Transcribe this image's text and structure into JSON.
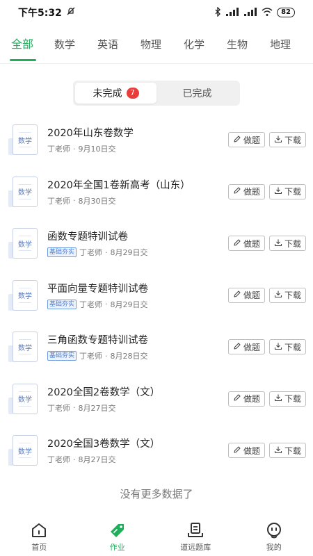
{
  "status_bar": {
    "time": "下午5:32",
    "battery": "82"
  },
  "subject_tabs": [
    "全部",
    "数学",
    "英语",
    "物理",
    "化学",
    "生物",
    "地理"
  ],
  "segment": {
    "incomplete_label": "未完成",
    "incomplete_count": "7",
    "complete_label": "已完成"
  },
  "doc_icon_label": "数学",
  "actions": {
    "do_label": "做题",
    "download_label": "下载"
  },
  "assignments": [
    {
      "title": "2020年山东卷数学",
      "tag": "",
      "teacher": "丁老师",
      "sep": "·",
      "date": "9月10日交"
    },
    {
      "title": "2020年全国1卷新高考（山东）",
      "tag": "",
      "teacher": "丁老师",
      "sep": "·",
      "date": "8月30日交"
    },
    {
      "title": "函数专题特训试卷",
      "tag": "基础夯实",
      "teacher": "丁老师",
      "sep": "·",
      "date": "8月29日交"
    },
    {
      "title": "平面向量专题特训试卷",
      "tag": "基础夯实",
      "teacher": "丁老师",
      "sep": "·",
      "date": "8月29日交"
    },
    {
      "title": "三角函数专题特训试卷",
      "tag": "基础夯实",
      "teacher": "丁老师",
      "sep": "·",
      "date": "8月28日交"
    },
    {
      "title": "2020全国2卷数学（文）",
      "tag": "",
      "teacher": "丁老师",
      "sep": "·",
      "date": "8月27日交"
    },
    {
      "title": "2020全国3卷数学（文）",
      "tag": "",
      "teacher": "丁老师",
      "sep": "·",
      "date": "8月27日交"
    }
  ],
  "no_more_text": "没有更多数据了",
  "bottom_nav": [
    {
      "label": "首页",
      "icon": "home-icon"
    },
    {
      "label": "作业",
      "icon": "homework-tag-icon",
      "active": true
    },
    {
      "label": "道远题库",
      "icon": "question-bank-icon"
    },
    {
      "label": "我的",
      "icon": "profile-face-icon"
    }
  ],
  "colors": {
    "accent": "#1fae5a",
    "badge": "#ec3b3b",
    "tag": "#4b7dd2"
  }
}
